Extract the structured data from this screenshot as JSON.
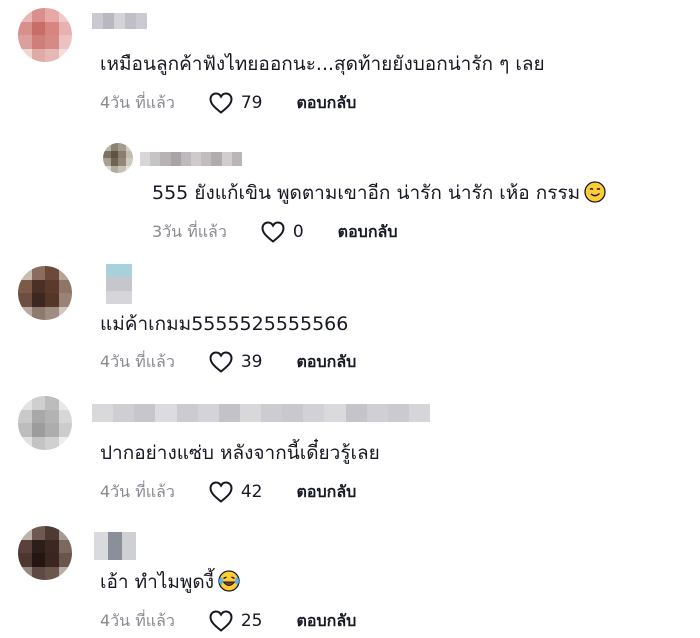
{
  "comments": [
    {
      "text": "เหมือนลูกค้าฟังไทยออกนะ...สุดท้ายยังบอกน่ารัก ๆ เลย",
      "time": "4วัน ที่แล้ว",
      "likes": "79",
      "reply_label": "ตอบกลับ",
      "avatar_colors": [
        "#e9b7b4",
        "#d9908c",
        "#e8a9a6",
        "#f0c9c6",
        "#d98f8b",
        "#c96d69",
        "#d88580",
        "#e6b2af",
        "#dca09c",
        "#cf7e79",
        "#d58a85",
        "#ebc2bf",
        "#f2d6d4",
        "#e0aaa6",
        "#e6b8b5",
        "#f4dedc"
      ],
      "name_colors": [
        "#c9c9cf",
        "#b8b8c0",
        "#d3d3d8",
        "#bfbfc7",
        "#cacad0"
      ]
    },
    {
      "text": "555 ยังแก้เขิน พูดตามเขาอีก น่ารัก น่ารัก เห้อ กรรม",
      "time": "3วัน ที่แล้ว",
      "likes": "0",
      "reply_label": "ตอบกลับ",
      "emoji": "smirk-emoji",
      "avatar_colors": [
        "#b9b2a6",
        "#8c8273",
        "#a39b8d",
        "#d1ccc3",
        "#7d7262",
        "#5e5446",
        "#8a7f6e",
        "#c2bbb0",
        "#a79f92",
        "#6f6555",
        "#938878",
        "#cfc9bf",
        "#ddd8d0",
        "#b3ab9f",
        "#c8c1b6",
        "#e4e0da"
      ],
      "name_colors": [
        "#d8d6d6",
        "#c7c4c5",
        "#b7b3b5",
        "#a9a4a7",
        "#bdb9bc",
        "#cdcacb",
        "#c1bdbf",
        "#b0acae",
        "#d0cdce",
        "#bab6b8"
      ]
    },
    {
      "text": "แม่ค้าเกมม5555525555566",
      "time": "4วัน ที่แล้ว",
      "likes": "39",
      "reply_label": "ตอบกลับ",
      "avatar_colors": [
        "#c8bcb2",
        "#8a6d5e",
        "#6b4a3b",
        "#b5a398",
        "#7c5a48",
        "#4a3025",
        "#5b3a2b",
        "#8f7566",
        "#6e4e3f",
        "#3d2720",
        "#553728",
        "#9a8274",
        "#b9aaa1",
        "#8e7a6e",
        "#a08d81",
        "#d2c7c0"
      ],
      "name_colors": [
        "#a9d1dc",
        "#c5c7cc",
        "#d6d6da"
      ]
    },
    {
      "text": "ปากอย่างแซ่บ หลังจากนี้เดี๋ยวรู้เลย",
      "time": "4วัน ที่แล้ว",
      "likes": "42",
      "reply_label": "ตอบกลับ",
      "avatar_colors": [
        "#e3e3e3",
        "#cfcfcf",
        "#bcbcbc",
        "#e8e8e8",
        "#c9c9c9",
        "#a8a8a8",
        "#b3b3b3",
        "#d7d7d7",
        "#bdbdbd",
        "#9c9c9c",
        "#adadad",
        "#cccccc",
        "#e1e1e1",
        "#c4c4c4",
        "#d0d0d0",
        "#eeeeee"
      ],
      "name_colors": [
        "#d9d9dc",
        "#cfcfd3",
        "#c6c6cb",
        "#dcdce0",
        "#cbcbd0",
        "#d4d4d8",
        "#c2c2c7",
        "#d8d8db",
        "#cdcdd1",
        "#c8c8cd",
        "#d2d2d6",
        "#dadadd",
        "#c4c4c9",
        "#d0d0d4",
        "#cacacf",
        "#d6d6da"
      ]
    },
    {
      "text": "เอ้า ทำไมพูดงี้",
      "time": "4วัน ที่แล้ว",
      "likes": "25",
      "reply_label": "ตอบกลับ",
      "emoji": "tears-of-joy-emoji",
      "avatar_colors": [
        "#bdb3ad",
        "#6e5a52",
        "#4f3a33",
        "#a59992",
        "#5b4139",
        "#2e1e1a",
        "#3c2822",
        "#7d6860",
        "#4d3630",
        "#231512",
        "#3a251f",
        "#6a554d",
        "#958880",
        "#5e4a42",
        "#6b564e",
        "#b7ada7"
      ],
      "name_colors": [
        "#d9dadd",
        "#8a8f99",
        "#cfd0d4"
      ]
    }
  ]
}
